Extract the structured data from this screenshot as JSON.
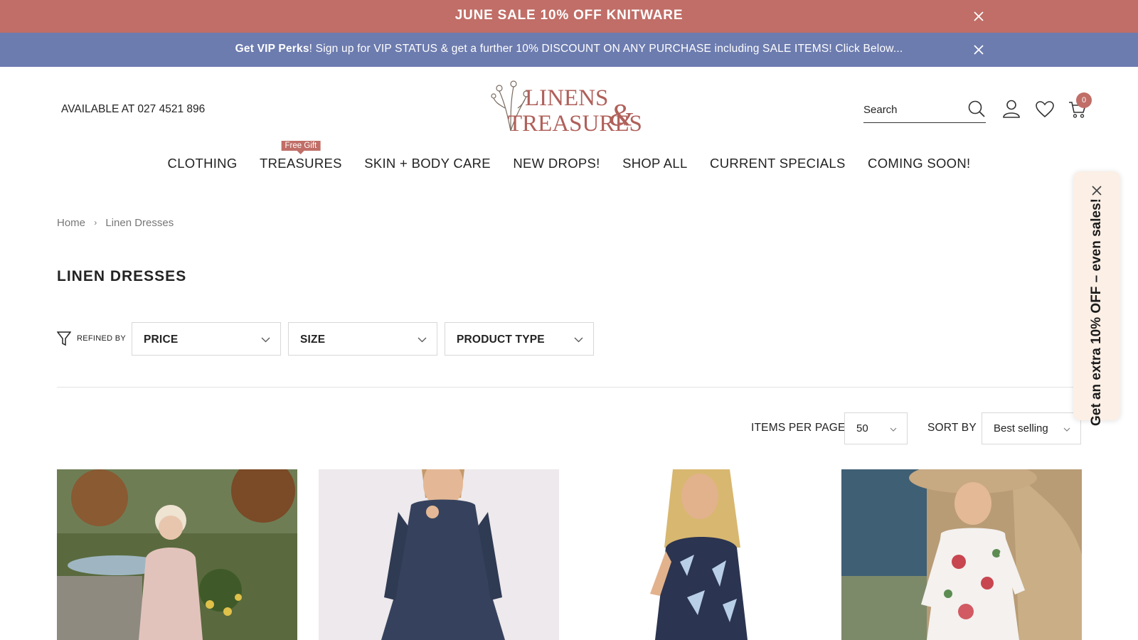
{
  "announcement": {
    "sale_text": "JUNE SALE 10% OFF KNITWARE",
    "vip_bold": "Get VIP Perks",
    "vip_text": "! Sign up for VIP STATUS & get a further 10% DISCOUNT ON ANY PURCHASE including SALE ITEMS! Click Below..."
  },
  "header": {
    "phone_text": "AVAILABLE AT 027 4521 896",
    "logo_text_line1": "LINENS",
    "logo_text_line2": "TREASURES",
    "logo_ampersand": "&",
    "search_placeholder": "Search",
    "cart_count": "0"
  },
  "nav": {
    "items": [
      {
        "label": "CLOTHING"
      },
      {
        "label": "TREASURES",
        "badge": "Free Gift"
      },
      {
        "label": "SKIN + BODY CARE"
      },
      {
        "label": "NEW DROPS!"
      },
      {
        "label": "SHOP ALL"
      },
      {
        "label": "CURRENT SPECIALS"
      },
      {
        "label": "COMING SOON!"
      }
    ]
  },
  "breadcrumb": {
    "home": "Home",
    "current": "Linen Dresses"
  },
  "page": {
    "title": "LINEN DRESSES"
  },
  "filters": {
    "refined_by_label": "REFINED BY",
    "price": "PRICE",
    "size": "SIZE",
    "product_type": "PRODUCT TYPE"
  },
  "toolbar": {
    "items_per_page_label": "ITEMS PER PAGE",
    "items_per_page_value": "50",
    "sort_by_label": "SORT BY",
    "sort_by_value": "Best selling"
  },
  "promo": {
    "text": "Get an extra 10% OFF – even sales!"
  },
  "colors": {
    "sale_bar": "#c06e67",
    "vip_bar": "#6d7caf",
    "brand": "#b0605a",
    "promo_tab": "#fbefe6"
  },
  "icons": [
    "close-icon",
    "search-icon",
    "user-icon",
    "heart-icon",
    "cart-icon",
    "filter-icon",
    "chevron-down-icon"
  ]
}
